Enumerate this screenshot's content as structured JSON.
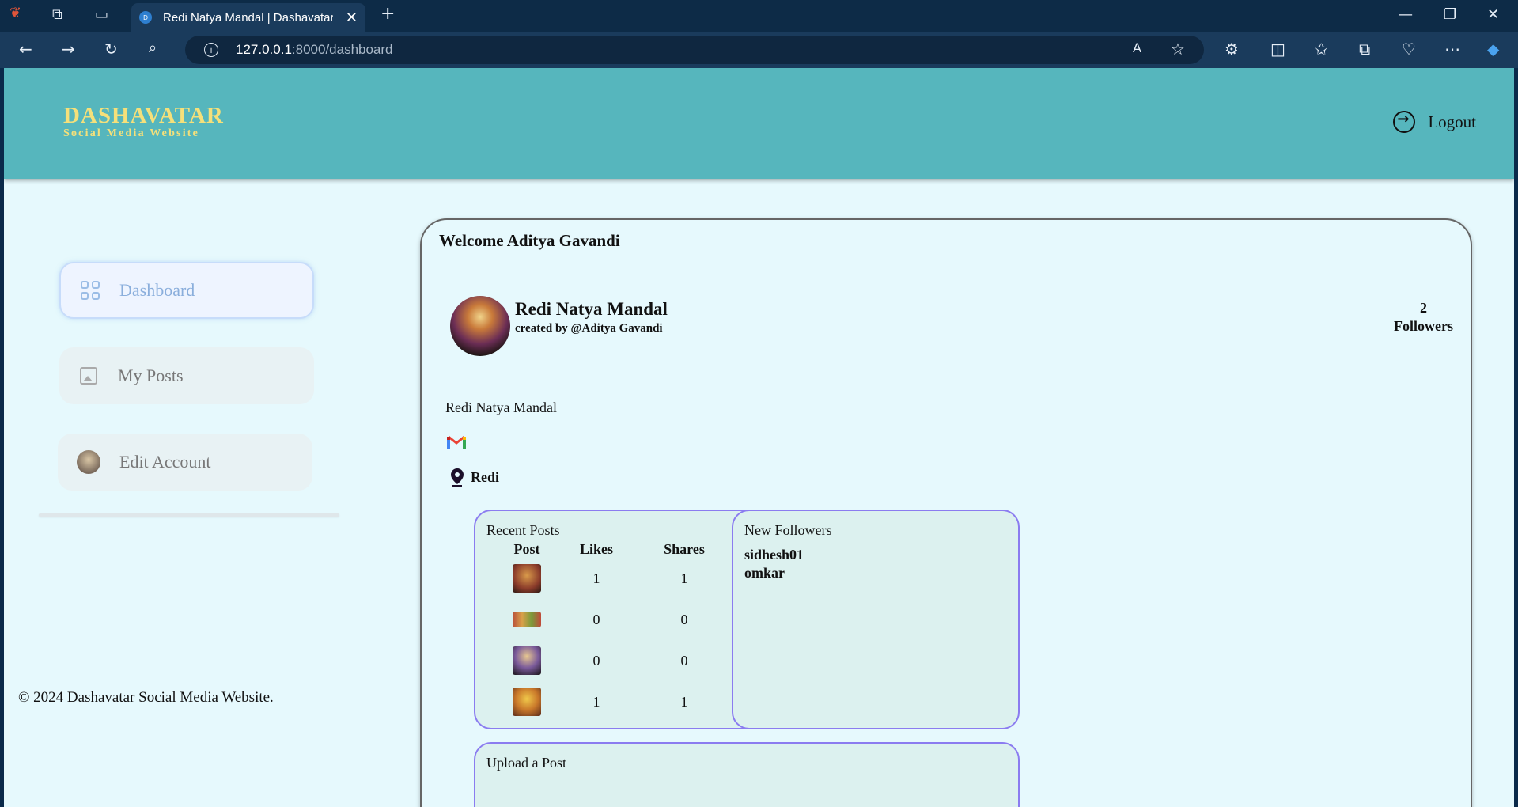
{
  "browser": {
    "tab_title": "Redi Natya Mandal | Dashavatar",
    "tab_favicon_letter": "D",
    "url_host": "127.0.0.1",
    "url_path": ":8000/dashboard"
  },
  "header": {
    "brand_title": "DASHAVATAR",
    "brand_subtitle": "Social Media Website",
    "logout_label": "Logout",
    "brand_color": "#f5e07a",
    "bg_color": "#56b6bd"
  },
  "sidebar": {
    "items": [
      {
        "label": "Dashboard",
        "icon": "dashboard-grid-icon",
        "active": true
      },
      {
        "label": "My Posts",
        "icon": "image-icon",
        "active": false
      },
      {
        "label": "Edit Account",
        "icon": "avatar",
        "active": false
      }
    ]
  },
  "footer": {
    "text": "© 2024 Dashavatar Social Media Website."
  },
  "main": {
    "welcome": "Welcome Aditya Gavandi",
    "profile": {
      "name": "Redi Natya Mandal",
      "creator": "created by @Aditya Gavandi",
      "followers_count": "2",
      "followers_label": "Followers",
      "description": "Redi Natya Mandal",
      "location": "Redi"
    },
    "recent_posts": {
      "title": "Recent Posts",
      "columns": [
        "Post",
        "Likes",
        "Shares"
      ],
      "rows": [
        {
          "likes": "1",
          "shares": "1",
          "thumb_color": "#8a3b2a"
        },
        {
          "likes": "0",
          "shares": "0",
          "thumb_color": "#b8503a"
        },
        {
          "likes": "0",
          "shares": "0",
          "thumb_color": "#3a2a40"
        },
        {
          "likes": "1",
          "shares": "1",
          "thumb_color": "#c9782a"
        }
      ]
    },
    "new_followers": {
      "title": "New Followers",
      "items": [
        "sidhesh01",
        "omkar"
      ]
    },
    "upload": {
      "title": "Upload a Post"
    }
  }
}
